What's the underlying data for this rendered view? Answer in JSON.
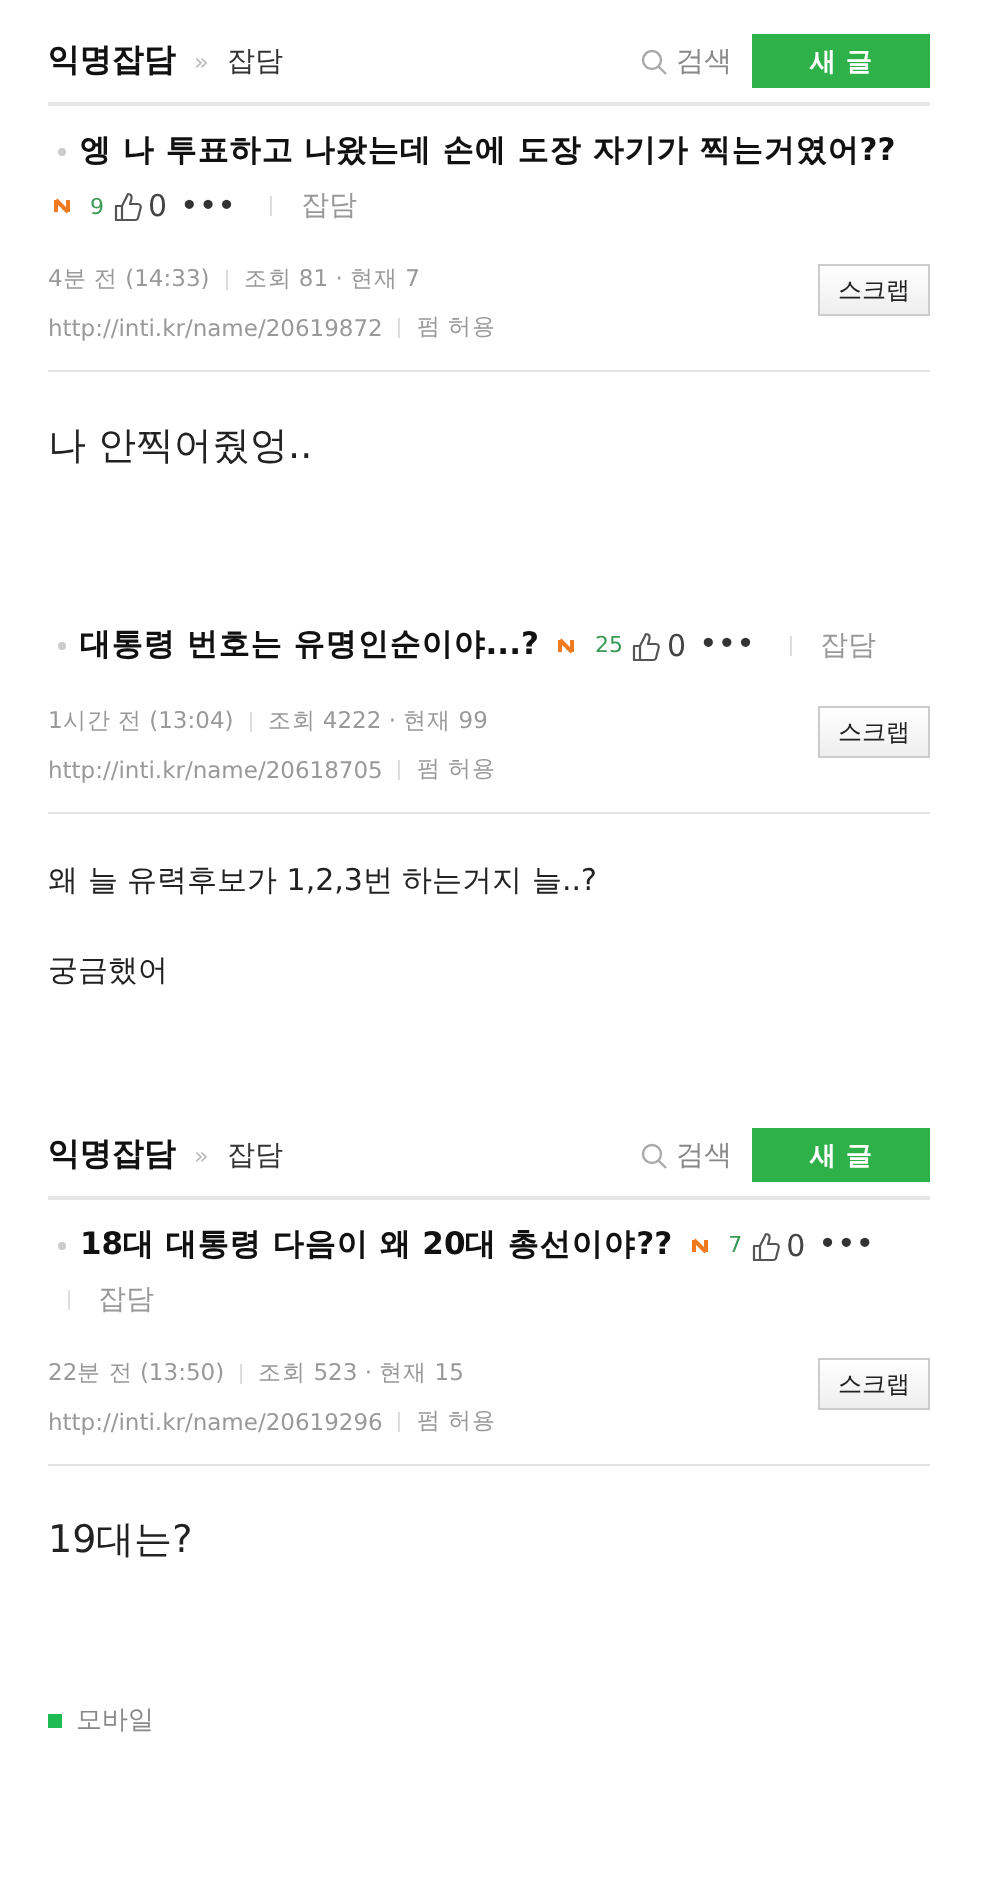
{
  "sections": [
    {
      "board": {
        "name": "익명잡담",
        "separator": "»",
        "category": "잡담",
        "search": "검색",
        "new_post": "새 글"
      },
      "post": {
        "title": "엥 나 투표하고 나왔는데 손에 도장 자기가 찍는거였어??",
        "is_new": true,
        "comments": "9",
        "likes": "0",
        "more": "•••",
        "category": "잡담",
        "time": "4분 전 (14:33)",
        "views": "조회 81 · 현재 7",
        "url": "http://inti.kr/name/20619872",
        "permission": "펌 허용",
        "scrap": "스크랩"
      },
      "body": [
        {
          "kind": "big",
          "text": "나 안찍어줬엉.."
        }
      ]
    },
    {
      "post": {
        "title": "대통령 번호는 유명인순이야...?",
        "is_new": true,
        "comments": "25",
        "likes": "0",
        "more": "•••",
        "category": "잡담",
        "time": "1시간 전 (13:04)",
        "views": "조회 4222 · 현재 99",
        "url": "http://inti.kr/name/20618705",
        "permission": "펌 허용",
        "scrap": "스크랩"
      },
      "body": [
        {
          "kind": "plain",
          "text": "왜 늘 유력후보가 1,2,3번 하는거지 늘..?"
        },
        {
          "kind": "plain",
          "text": "궁금했어"
        }
      ]
    },
    {
      "board": {
        "name": "익명잡담",
        "separator": "»",
        "category": "잡담",
        "search": "검색",
        "new_post": "새 글"
      },
      "post": {
        "title": "18대 대통령 다음이 왜 20대 총선이야??",
        "is_new": true,
        "comments": "7",
        "likes": "0",
        "more": "•••",
        "category": "잡담",
        "time": "22분 전 (13:50)",
        "views": "조회 523 · 현재 15",
        "url": "http://inti.kr/name/20619296",
        "permission": "펌 허용",
        "scrap": "스크랩"
      },
      "body": [
        {
          "kind": "big",
          "text": "19대는?"
        }
      ]
    }
  ],
  "footer": {
    "label": "모바일"
  }
}
